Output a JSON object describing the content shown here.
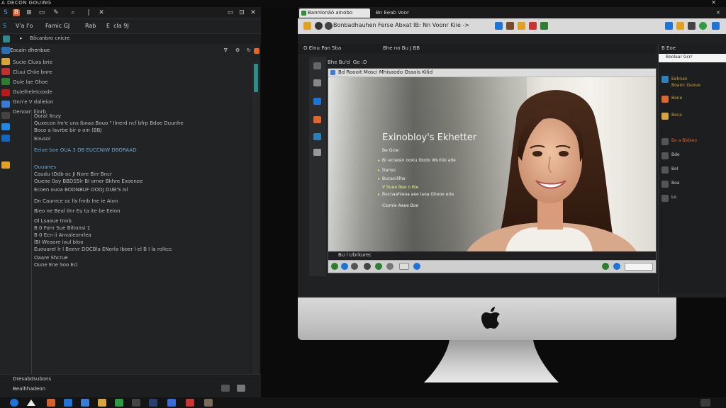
{
  "window": {
    "title": "A DECON GOUING"
  },
  "editor": {
    "menu": [
      "V'a l'o",
      "Famic GJ",
      "Rab",
      "E  cla 9J"
    ],
    "sub_label": "Bâcanbro cnicre",
    "panel_label": "Eocain dhenbue",
    "sidebar_labels": [
      "Sucie Cluxs brie",
      "Cluui Chiie bnre",
      "Ouie lae Ghoe",
      "Guielheleicoxde",
      "Gnn'e V dalieion",
      "Denoan liinrb"
    ],
    "code_lines": [
      {
        "text": "Ooral Xnzy",
        "color": "normal"
      },
      {
        "text": "Quxecon lm'e uns Iboaa Bouo ³ Ilnerd ncf bfrp Bdoe Duunhe",
        "color": "normal"
      },
      {
        "text": "Boco a lavrbe bir o oin (BBJ",
        "color": "normal"
      },
      {
        "text": "Eousol",
        "color": "normal"
      },
      {
        "text": "Eeioe boe OUA 3 DB EUCCNIW DBORAAD",
        "color": "blue"
      },
      {
        "text": "Ouuanes",
        "color": "blue"
      },
      {
        "text": "Caudu tDdb oc Ji Nore Birr Bncr",
        "color": "normal"
      },
      {
        "text": "Ouene 0ay BBDS5lr BI omer Bkhre  Exoenee",
        "color": "normal"
      },
      {
        "text": "Ecoen ouoa BOONBUF OOOJ DUB'S Isl",
        "color": "normal"
      },
      {
        "text": "Dn Caunrce oc lls fnnb Ine ie Aion",
        "color": "normal"
      },
      {
        "text": "Bieo ne Beal Ilnr Eu ta ite be Eeion",
        "color": "normal"
      },
      {
        "text": "Ol Lsaoue tnnb",
        "color": "normal"
      },
      {
        "text": "B 0 Fonr Sue Bitionsi 1",
        "color": "normal"
      },
      {
        "text": "B 0 Ecn ii Anvaleonrlea",
        "color": "normal"
      },
      {
        "text": "lBI Weaore ioul bloo",
        "color": "normal"
      },
      {
        "text": "Euouarel lr l Beevr DOCBla ENorla Iboer l el B I la rolkcc",
        "color": "normal"
      },
      {
        "text": "Oaare Shcrue",
        "color": "normal"
      },
      {
        "text": "Oune Ene Soo Ecl",
        "color": "normal"
      }
    ],
    "status": [
      "Dresabdsubons",
      "Bealhhadeon"
    ]
  },
  "monitor": {
    "tab_title": "Bannlonäö ainobo",
    "tab2_label": "Bn  Eeab Voor",
    "address": "Bonbadhauhen Ferse Abxat IB: Nn Voonr Kiie ->",
    "panel_labels": [
      "O Elnu Pan 5ba",
      "Bhe no Bu J BB"
    ],
    "inner_header": "Bhe Bu'd  Ge :D",
    "doc_title": "Bd Roooit Mosci Mhisaodo  Ossois Kilid",
    "overlay": {
      "title": "Exinobloy's Ekhetter",
      "lines": [
        {
          "text": "Be Gioe",
          "highlight": false
        },
        {
          "text": "Br ecoesin ooxiu Ibodo Wuriiio ade",
          "highlight": false
        },
        {
          "text": "Danso",
          "highlight": false
        },
        {
          "text": "Bucanilllhe",
          "highlight": false
        },
        {
          "text": "V Suee Beo o Bie",
          "highlight": true
        },
        {
          "text": "Bocnaahieoa aee Iaoa Ghooe erie",
          "highlight": false
        },
        {
          "text": "Ciomie Aaee Boe",
          "highlight": false
        }
      ]
    },
    "doc_status": "Bu l Ubrkurec",
    "right_panel": {
      "header": "B Eoe",
      "bar_label": "Boolaar Gcrr",
      "items": [
        {
          "label": "Eehnan\nBoaro: Guove",
          "style": "orange",
          "icon_color": "#2c7fb8"
        },
        {
          "label": "Bone",
          "style": "orange",
          "icon_color": "#e0662b"
        },
        {
          "label": "Boca",
          "style": "orange",
          "icon_color": "#d8a53a"
        },
        {
          "label": "Bo a Bbbieo",
          "style": "red",
          "icon_color": "#555"
        },
        {
          "label": "Bde",
          "style": "white",
          "icon_color": "#555"
        },
        {
          "label": "Bol",
          "style": "white",
          "icon_color": "#555"
        },
        {
          "label": "Boa",
          "style": "white",
          "icon_color": "#555"
        },
        {
          "label": "Lo",
          "style": "white",
          "icon_color": "#555"
        }
      ]
    }
  },
  "colors": {
    "editor_bg": "#222325",
    "accent_teal": "#2f8a8a",
    "code_blue": "#6fa8d8",
    "overlay_highlight": "#e8f58a"
  }
}
